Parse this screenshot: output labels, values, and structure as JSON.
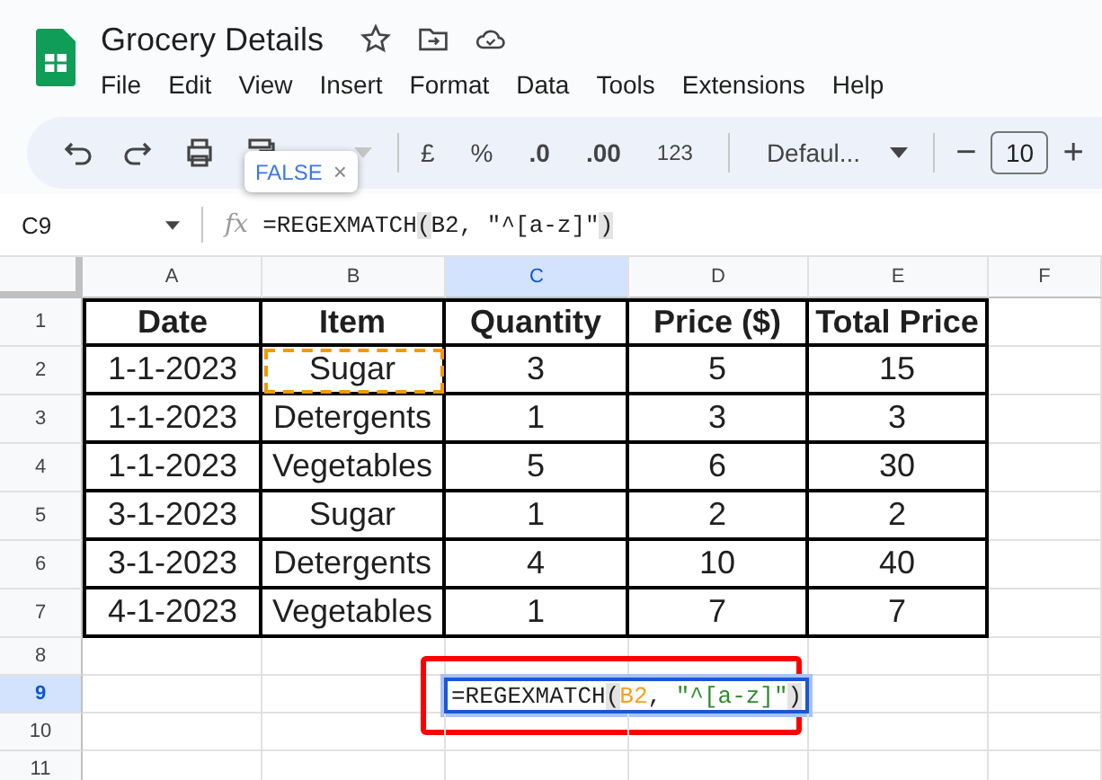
{
  "app": {
    "title": "Grocery Details",
    "menu": [
      "File",
      "Edit",
      "View",
      "Insert",
      "Format",
      "Data",
      "Tools",
      "Extensions",
      "Help"
    ]
  },
  "toolbar": {
    "zoom": {
      "disabled": true
    },
    "currency": "£",
    "percent": "%",
    "decrease_decimals": ".0",
    "increase_decimals": ".00",
    "number_format": "123",
    "font": "Defaul...",
    "font_size": "10",
    "minus": "−",
    "plus": "+"
  },
  "tooltip": {
    "text": "FALSE",
    "close": "×"
  },
  "formula_bar": {
    "name_box": "C9",
    "fx": "fx",
    "tokens": [
      {
        "kind": "plain",
        "text": "=REGEXMATCH"
      },
      {
        "kind": "paren",
        "text": "("
      },
      {
        "kind": "plain",
        "text": "B2, \"^[a-z]\""
      },
      {
        "kind": "paren",
        "text": ")"
      }
    ]
  },
  "sheet": {
    "columns": [
      {
        "label": "A",
        "selected": false
      },
      {
        "label": "B",
        "selected": false
      },
      {
        "label": "C",
        "selected": true
      },
      {
        "label": "D",
        "selected": false
      },
      {
        "label": "E",
        "selected": false
      },
      {
        "label": "F",
        "selected": false
      }
    ],
    "rows": [
      {
        "label": "1",
        "selected": false,
        "cells": [
          {
            "text": "Date",
            "copied": false
          },
          {
            "text": "Item",
            "copied": false
          },
          {
            "text": "Quantity",
            "copied": false
          },
          {
            "text": "Price ($)",
            "copied": false
          },
          {
            "text": "Total Price",
            "copied": false
          }
        ]
      },
      {
        "label": "2",
        "selected": false,
        "cells": [
          {
            "text": "1-1-2023",
            "copied": false
          },
          {
            "text": "Sugar",
            "copied": true
          },
          {
            "text": "3",
            "copied": false
          },
          {
            "text": "5",
            "copied": false
          },
          {
            "text": "15",
            "copied": false
          }
        ]
      },
      {
        "label": "3",
        "selected": false,
        "cells": [
          {
            "text": "1-1-2023",
            "copied": false
          },
          {
            "text": "Detergents",
            "copied": false
          },
          {
            "text": "1",
            "copied": false
          },
          {
            "text": "3",
            "copied": false
          },
          {
            "text": "3",
            "copied": false
          }
        ]
      },
      {
        "label": "4",
        "selected": false,
        "cells": [
          {
            "text": "1-1-2023",
            "copied": false
          },
          {
            "text": "Vegetables",
            "copied": false
          },
          {
            "text": "5",
            "copied": false
          },
          {
            "text": "6",
            "copied": false
          },
          {
            "text": "30",
            "copied": false
          }
        ]
      },
      {
        "label": "5",
        "selected": false,
        "cells": [
          {
            "text": "3-1-2023",
            "copied": false
          },
          {
            "text": "Sugar",
            "copied": false
          },
          {
            "text": "1",
            "copied": false
          },
          {
            "text": "2",
            "copied": false
          },
          {
            "text": "2",
            "copied": false
          }
        ]
      },
      {
        "label": "6",
        "selected": false,
        "cells": [
          {
            "text": "3-1-2023",
            "copied": false
          },
          {
            "text": "Detergents",
            "copied": false
          },
          {
            "text": "4",
            "copied": false
          },
          {
            "text": "10",
            "copied": false
          },
          {
            "text": "40",
            "copied": false
          }
        ]
      },
      {
        "label": "7",
        "selected": false,
        "cells": [
          {
            "text": "4-1-2023",
            "copied": false
          },
          {
            "text": "Vegetables",
            "copied": false
          },
          {
            "text": "1",
            "copied": false
          },
          {
            "text": "7",
            "copied": false
          },
          {
            "text": "7",
            "copied": false
          }
        ]
      },
      {
        "label": "8",
        "selected": false
      },
      {
        "label": "9",
        "selected": true
      },
      {
        "label": "10",
        "selected": false
      },
      {
        "label": "11",
        "selected": false
      }
    ],
    "editor": {
      "highlighted": true,
      "tokens": [
        {
          "kind": "plain",
          "text": "=REGEXMATCH"
        },
        {
          "kind": "paren",
          "text": "("
        },
        {
          "kind": "ref",
          "text": "B2"
        },
        {
          "kind": "plain",
          "text": ", "
        },
        {
          "kind": "string",
          "text": "\"^[a-z]\""
        },
        {
          "kind": "paren",
          "text": ")"
        }
      ]
    }
  }
}
